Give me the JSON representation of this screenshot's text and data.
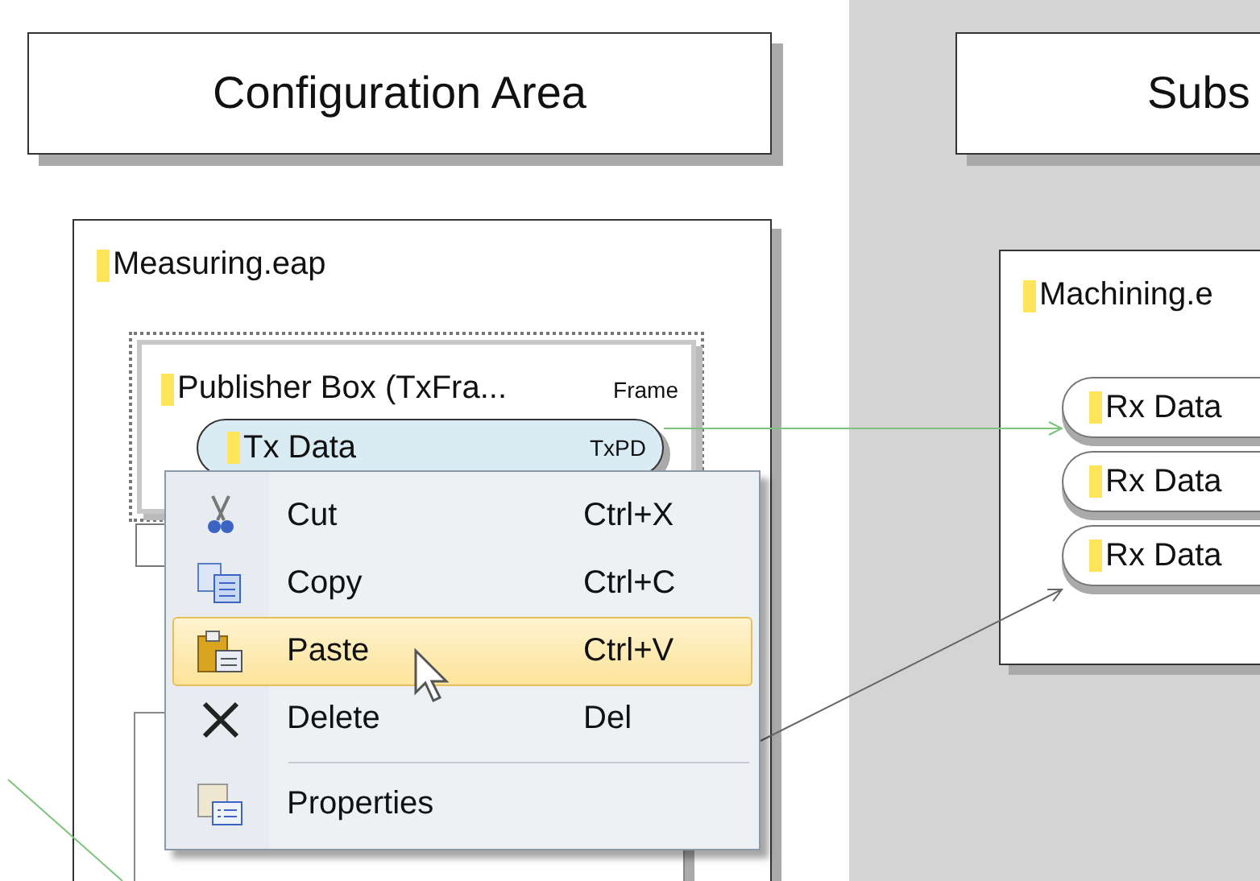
{
  "configuration_area": {
    "title": "Configuration Area",
    "project": {
      "name": "Measuring.eap",
      "publisher_box": {
        "title": "Publisher Box (TxFra...",
        "type": "Frame",
        "tx_data": {
          "label": "Tx Data",
          "type": "TxPD"
        }
      }
    }
  },
  "subscriber_area": {
    "title": "Subs",
    "project": {
      "name": "Machining.e",
      "rx_data": [
        {
          "label": "Rx Data"
        },
        {
          "label": "Rx Data"
        },
        {
          "label": "Rx Data"
        }
      ]
    }
  },
  "context_menu": {
    "items": [
      {
        "kind": "cut",
        "label": "Cut",
        "shortcut": "Ctrl+X",
        "selected": false
      },
      {
        "kind": "copy",
        "label": "Copy",
        "shortcut": "Ctrl+C",
        "selected": false
      },
      {
        "kind": "paste",
        "label": "Paste",
        "shortcut": "Ctrl+V",
        "selected": true
      },
      {
        "kind": "delete",
        "label": "Delete",
        "shortcut": "Del",
        "selected": false
      },
      {
        "kind": "separator"
      },
      {
        "kind": "properties",
        "label": "Properties",
        "selected": false
      }
    ]
  }
}
